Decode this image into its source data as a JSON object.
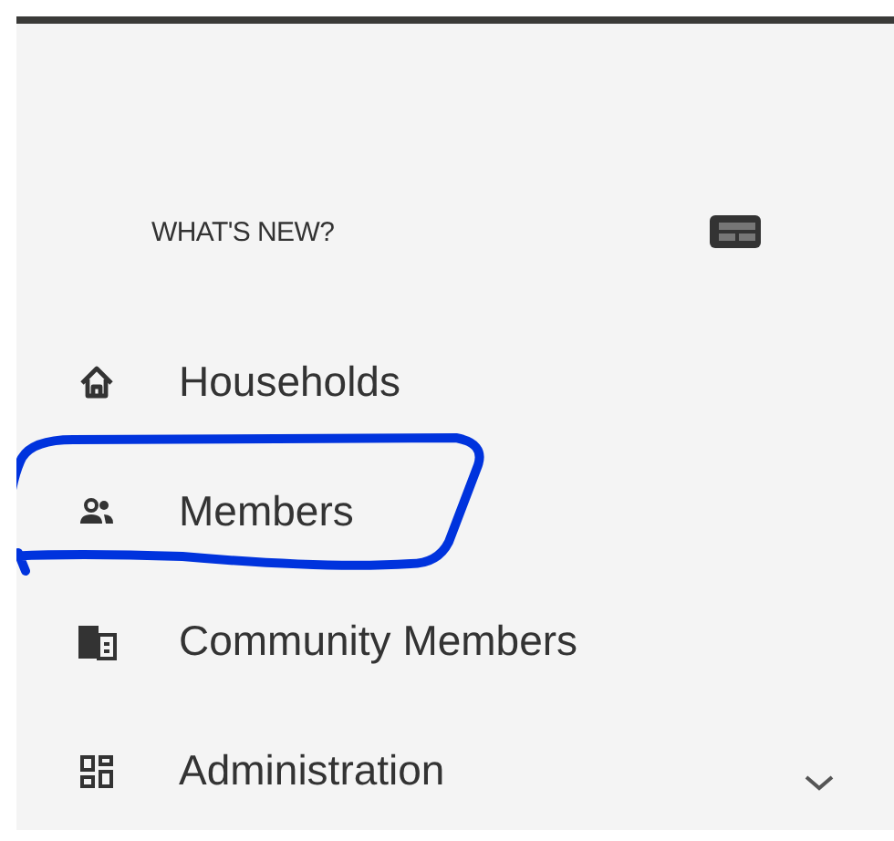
{
  "sidebar": {
    "heading": "WHAT'S NEW?",
    "items": [
      {
        "label": "Households",
        "kind": "link",
        "circled": false
      },
      {
        "label": "Members",
        "kind": "link",
        "circled": true
      },
      {
        "label": "Community Members",
        "kind": "link",
        "circled": false
      },
      {
        "label": "Administration",
        "kind": "group",
        "circled": false,
        "expanded": false
      }
    ]
  }
}
